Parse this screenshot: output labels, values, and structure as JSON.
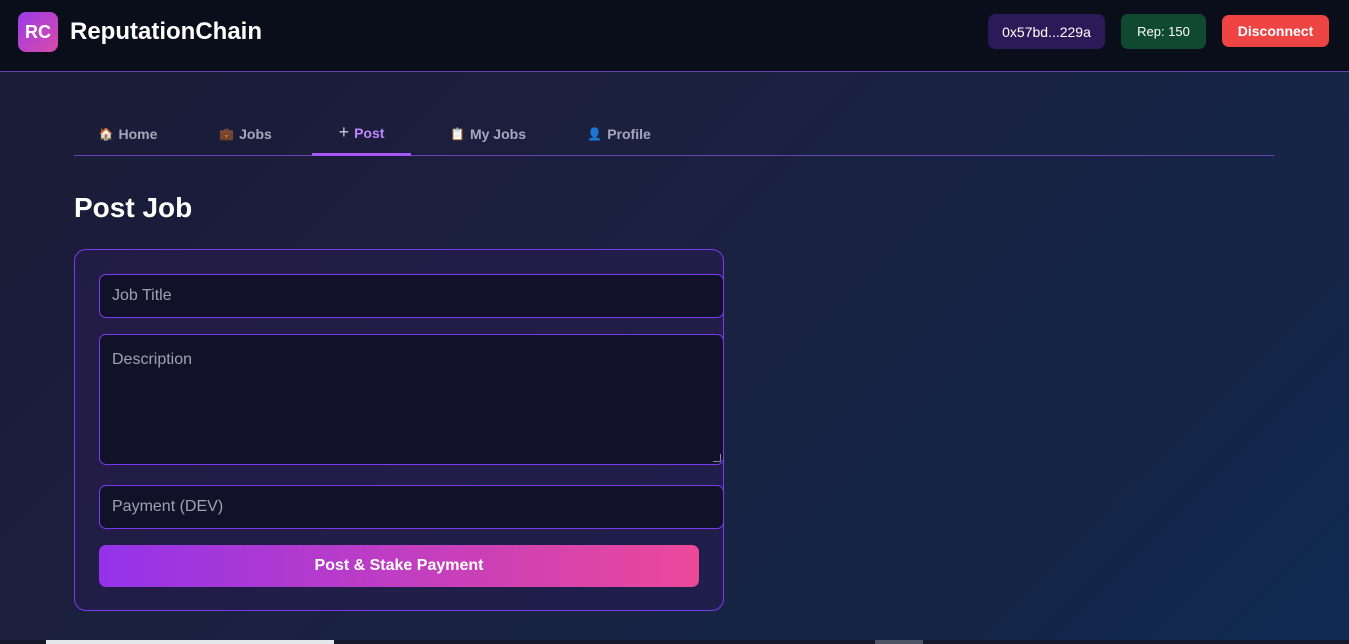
{
  "header": {
    "logo_text": "RC",
    "app_title": "ReputationChain",
    "address": "0x57bd...229a",
    "reputation": "Rep: 150",
    "disconnect_label": "Disconnect"
  },
  "tabs": [
    {
      "icon": "house-icon",
      "glyph": "🏠",
      "label": "Home",
      "active": false
    },
    {
      "icon": "briefcase-icon",
      "glyph": "💼",
      "label": "Jobs",
      "active": false
    },
    {
      "icon": "plus-icon",
      "glyph": "+",
      "label": "Post",
      "active": true
    },
    {
      "icon": "clipboard-icon",
      "glyph": "📋",
      "label": "My Jobs",
      "active": false
    },
    {
      "icon": "user-icon",
      "glyph": "👤",
      "label": "Profile",
      "active": false
    }
  ],
  "page": {
    "title": "Post Job"
  },
  "form": {
    "job_title_placeholder": "Job Title",
    "description_placeholder": "Description",
    "payment_placeholder": "Payment (DEV)",
    "submit_label": "Post & Stake Payment"
  },
  "colors": {
    "accent": "#a855f7",
    "danger": "#ef4444",
    "rep_bg": "#0f4a30",
    "gradient_start": "#9333ea",
    "gradient_end": "#ec4899"
  }
}
